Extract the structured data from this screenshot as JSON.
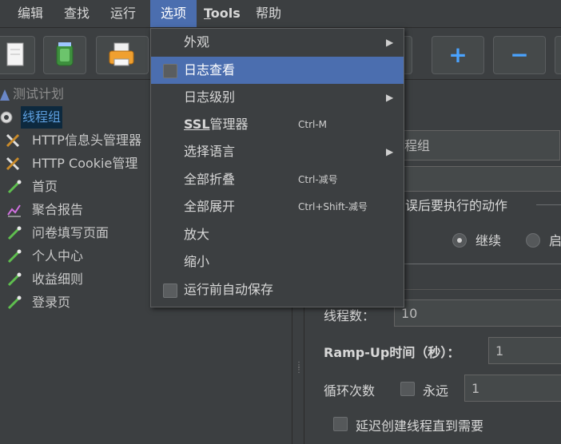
{
  "menubar": {
    "items": [
      "编辑",
      "查找",
      "运行",
      "选项",
      "Tools",
      "帮助"
    ],
    "tools_first": "T",
    "tools_rest": "ools"
  },
  "toolbar": {
    "plus": "+",
    "minus": "−"
  },
  "tree": {
    "items": [
      "测试计划",
      "线程组",
      "HTTP信息头管理器",
      "HTTP Cookie管理",
      "首页",
      "聚合报告",
      "问卷填写页面",
      "个人中心",
      "收益细则",
      "登录页"
    ]
  },
  "right_panel": {
    "name_fragment": "程组",
    "error_action_label": "误后要执行的动作",
    "continue_label": "继续",
    "start_fragment": "启",
    "threads_label": "线程数：",
    "threads_value": "10",
    "rampup_label": "Ramp-Up时间（秒）：",
    "rampup_value": "1",
    "loop_label": "循环次数",
    "forever_label": "永远",
    "loop_value": "1",
    "delay_label": "延迟创建线程直到需要"
  },
  "options_menu": {
    "items": [
      {
        "label": "外观",
        "shortcut": "",
        "submenu": true
      },
      {
        "label": "日志查看",
        "shortcut": "",
        "checkbox": true,
        "highlighted": true
      },
      {
        "label": "日志级别",
        "shortcut": "",
        "submenu": true
      },
      {
        "label_u": "SSL",
        "label_rest": "管理器",
        "shortcut": "Ctrl-M"
      },
      {
        "label": "选择语言",
        "shortcut": "",
        "submenu": true
      },
      {
        "label": "全部折叠",
        "shortcut": "Ctrl-减号"
      },
      {
        "label": "全部展开",
        "shortcut": "Ctrl+Shift-减号"
      },
      {
        "label": "放大",
        "shortcut": ""
      },
      {
        "label": "缩小",
        "shortcut": ""
      },
      {
        "label": "运行前自动保存",
        "shortcut": "",
        "checkbox": true
      }
    ],
    "arrow": "▶"
  },
  "colors": {
    "background": "#3c3f41",
    "highlight": "#4b6eaf",
    "selection": "#0d293e",
    "accent_blue": "#4aa3ff"
  },
  "icons": [
    "document-icon",
    "jar-icon",
    "printer-icon",
    "plus-icon",
    "minus-icon",
    "test-plan-icon",
    "gear-icon",
    "wrench-icon",
    "pipette-icon",
    "chart-icon"
  ]
}
